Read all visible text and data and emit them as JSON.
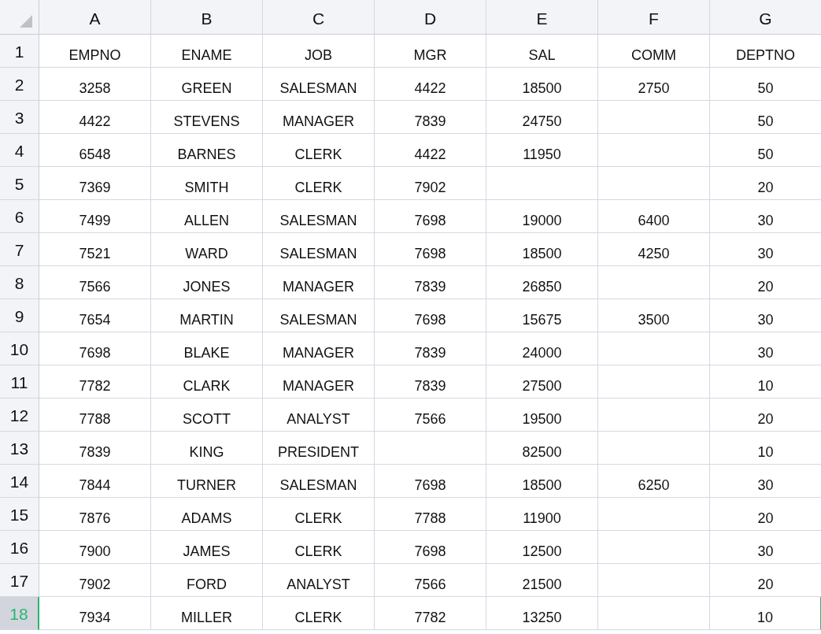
{
  "columns": [
    "A",
    "B",
    "C",
    "D",
    "E",
    "F",
    "G"
  ],
  "rows": [
    {
      "header": "1",
      "selected": false,
      "cells": [
        "EMPNO",
        "ENAME",
        "JOB",
        "MGR",
        "SAL",
        "COMM",
        "DEPTNO"
      ]
    },
    {
      "header": "2",
      "selected": false,
      "cells": [
        "3258",
        "GREEN",
        "SALESMAN",
        "4422",
        "18500",
        "2750",
        "50"
      ]
    },
    {
      "header": "3",
      "selected": false,
      "cells": [
        "4422",
        "STEVENS",
        "MANAGER",
        "7839",
        "24750",
        null,
        "50"
      ]
    },
    {
      "header": "4",
      "selected": false,
      "cells": [
        "6548",
        "BARNES",
        "CLERK",
        "4422",
        "11950",
        null,
        "50"
      ]
    },
    {
      "header": "5",
      "selected": false,
      "cells": [
        "7369",
        "SMITH",
        "CLERK",
        "7902",
        null,
        null,
        "20"
      ]
    },
    {
      "header": "6",
      "selected": false,
      "cells": [
        "7499",
        "ALLEN",
        "SALESMAN",
        "7698",
        "19000",
        "6400",
        "30"
      ]
    },
    {
      "header": "7",
      "selected": false,
      "cells": [
        "7521",
        "WARD",
        "SALESMAN",
        "7698",
        "18500",
        "4250",
        "30"
      ]
    },
    {
      "header": "8",
      "selected": false,
      "cells": [
        "7566",
        "JONES",
        "MANAGER",
        "7839",
        "26850",
        null,
        "20"
      ]
    },
    {
      "header": "9",
      "selected": false,
      "cells": [
        "7654",
        "MARTIN",
        "SALESMAN",
        "7698",
        "15675",
        "3500",
        "30"
      ]
    },
    {
      "header": "10",
      "selected": false,
      "cells": [
        "7698",
        "BLAKE",
        "MANAGER",
        "7839",
        "24000",
        null,
        "30"
      ]
    },
    {
      "header": "11",
      "selected": false,
      "cells": [
        "7782",
        "CLARK",
        "MANAGER",
        "7839",
        "27500",
        null,
        "10"
      ]
    },
    {
      "header": "12",
      "selected": false,
      "cells": [
        "7788",
        "SCOTT",
        "ANALYST",
        "7566",
        "19500",
        null,
        "20"
      ]
    },
    {
      "header": "13",
      "selected": false,
      "cells": [
        "7839",
        "KING",
        "PRESIDENT",
        null,
        "82500",
        null,
        "10"
      ]
    },
    {
      "header": "14",
      "selected": false,
      "cells": [
        "7844",
        "TURNER",
        "SALESMAN",
        "7698",
        "18500",
        "6250",
        "30"
      ]
    },
    {
      "header": "15",
      "selected": false,
      "cells": [
        "7876",
        "ADAMS",
        "CLERK",
        "7788",
        "11900",
        null,
        "20"
      ]
    },
    {
      "header": "16",
      "selected": false,
      "cells": [
        "7900",
        "JAMES",
        "CLERK",
        "7698",
        "12500",
        null,
        "30"
      ]
    },
    {
      "header": "17",
      "selected": false,
      "cells": [
        "7902",
        "FORD",
        "ANALYST",
        "7566",
        "21500",
        null,
        "20"
      ]
    },
    {
      "header": "18",
      "selected": true,
      "cells": [
        "7934",
        "MILLER",
        "CLERK",
        "7782",
        "13250",
        null,
        "10"
      ]
    }
  ]
}
